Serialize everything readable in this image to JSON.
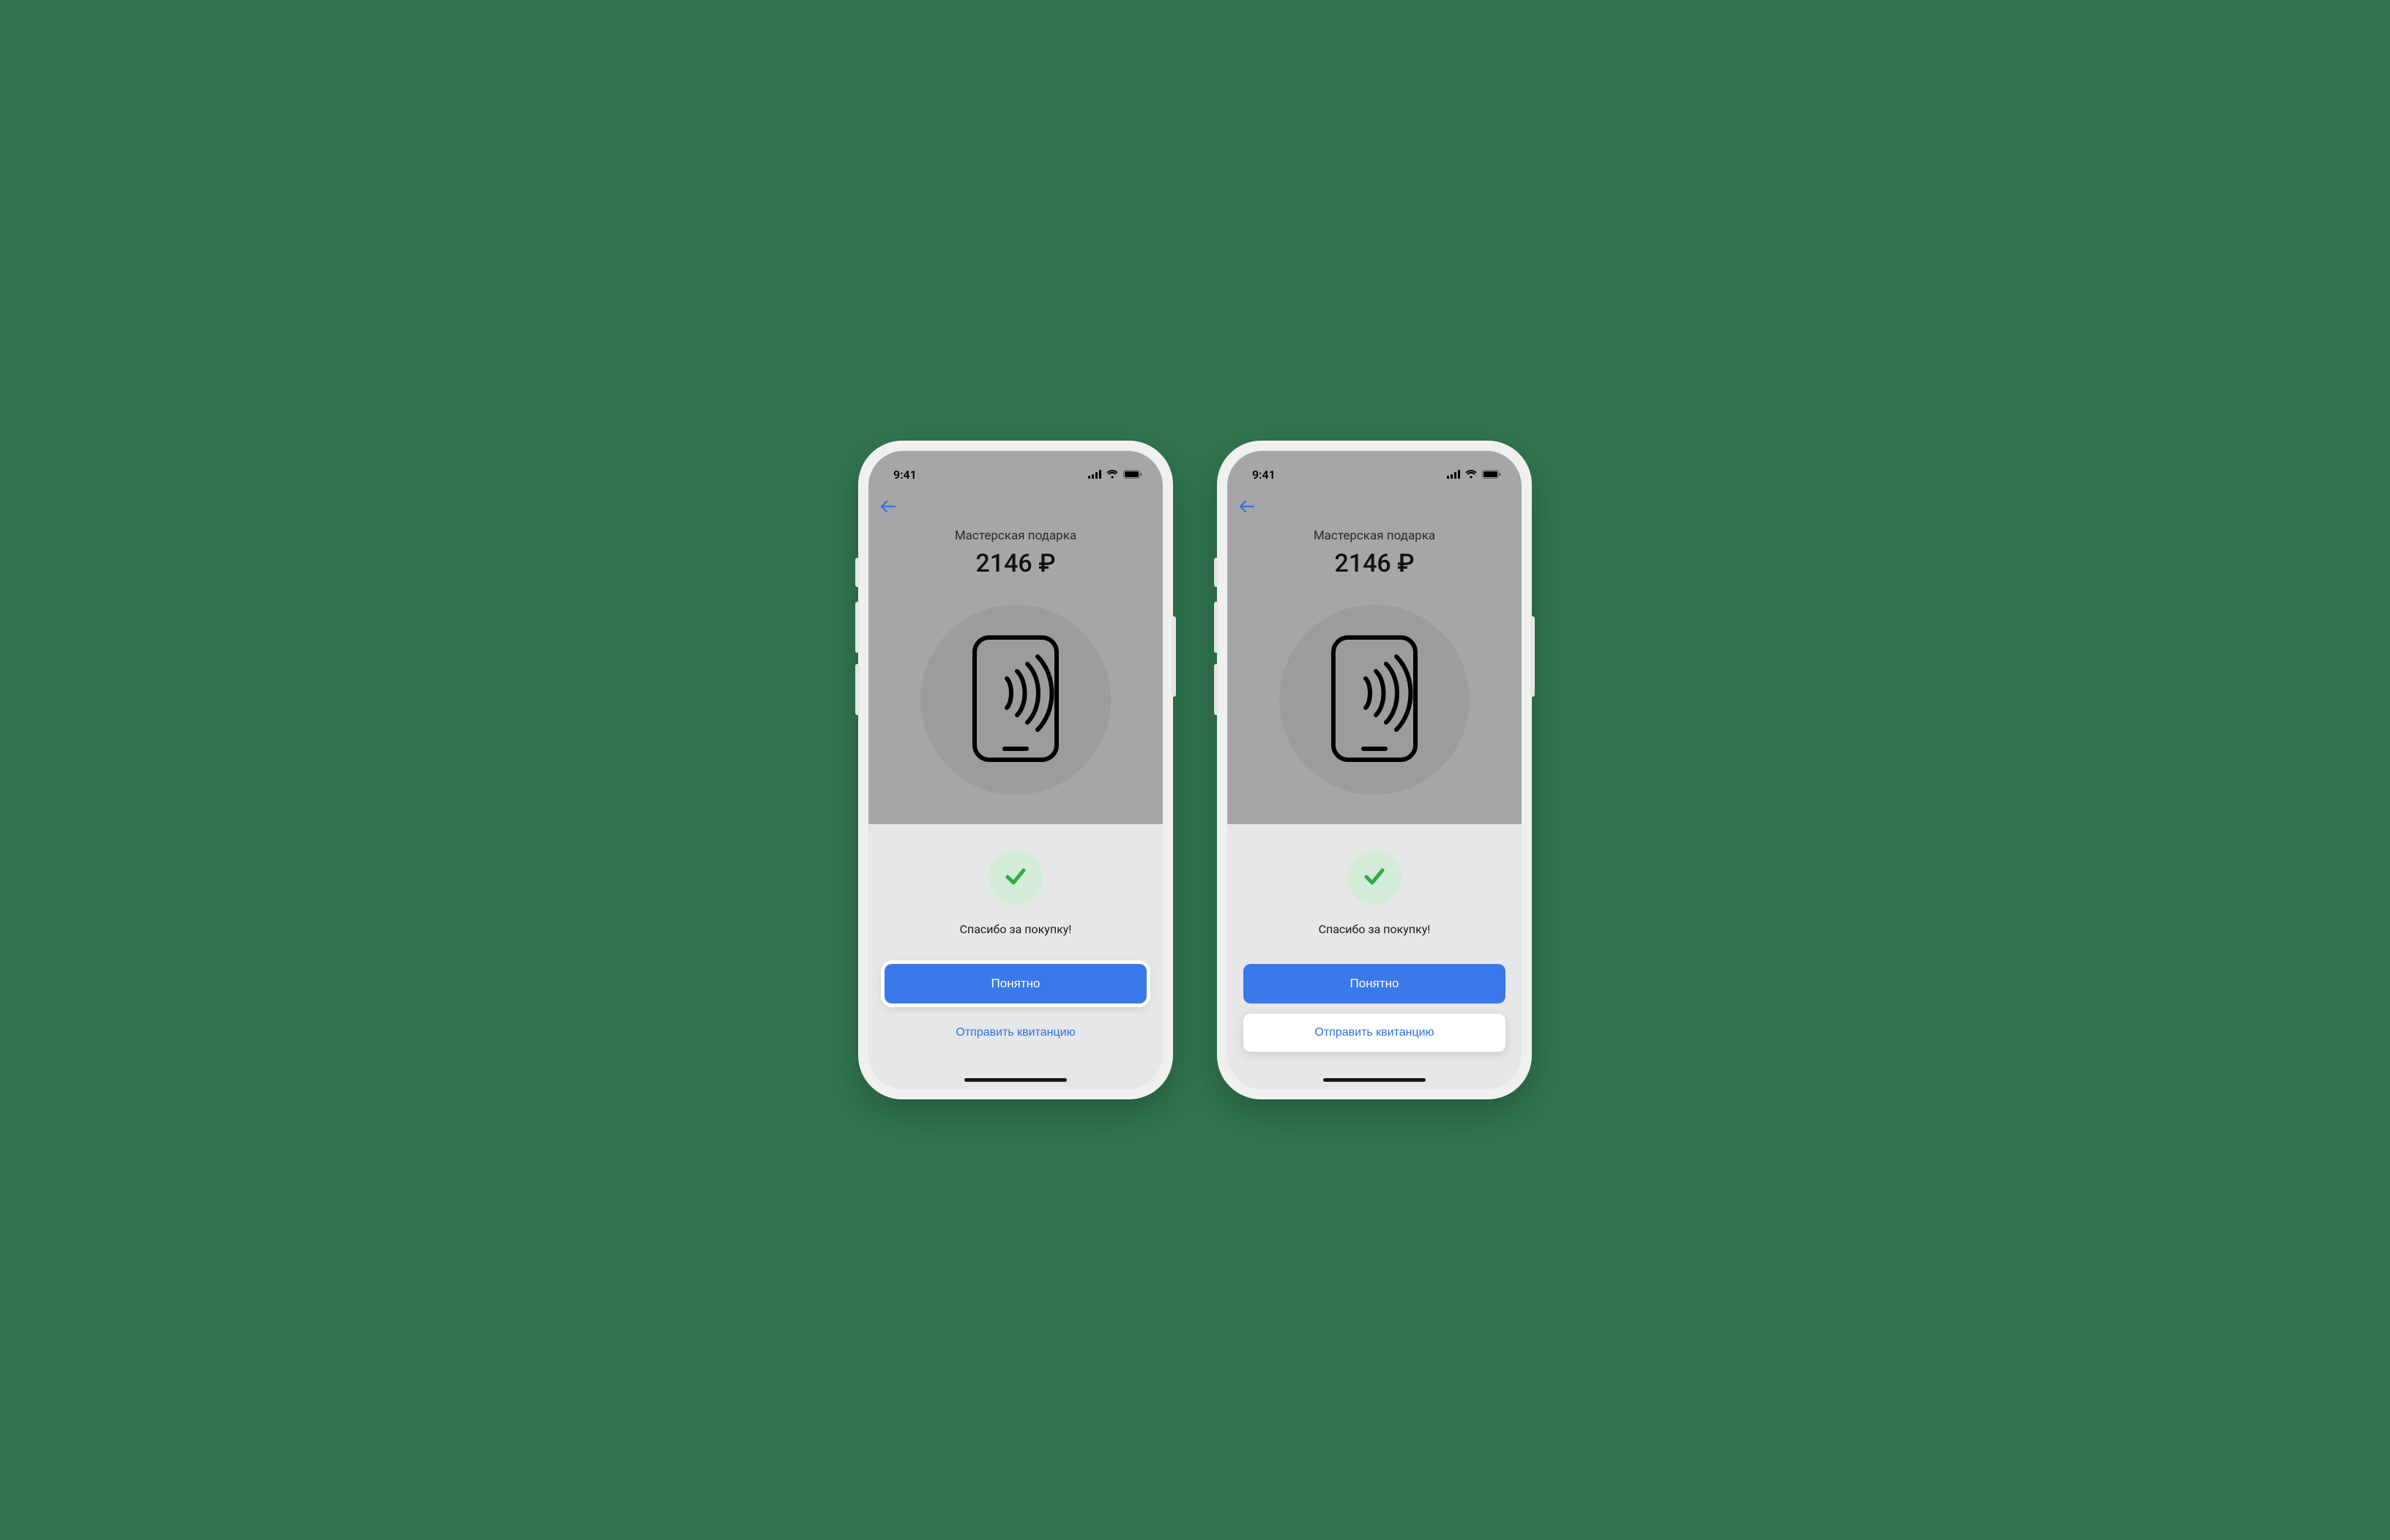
{
  "status": {
    "time": "9:41"
  },
  "payment": {
    "merchant": "Мастерская подарка",
    "amount": "2146 ₽",
    "success_message": "Спасибо за покупку!",
    "primary_button": "Понятно",
    "secondary_button": "Отправить квитанцию"
  },
  "icons": {
    "back": "back-arrow-icon",
    "nfc_phone": "nfc-phone-icon",
    "success_check": "check-icon",
    "signal": "cellular-signal-icon",
    "wifi": "wifi-icon",
    "battery": "battery-icon"
  },
  "colors": {
    "background": "#317650",
    "primary_button": "#3a79ea",
    "link": "#2e71e5",
    "success_bg": "#d3ecd8",
    "success_check": "#2faa4b"
  },
  "screens": [
    {
      "id": "left",
      "focused": "primary"
    },
    {
      "id": "right",
      "focused": "secondary"
    }
  ]
}
